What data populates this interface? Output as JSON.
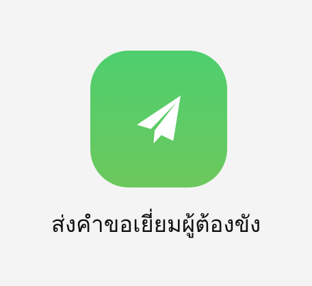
{
  "app": {
    "title": "ส่งคำขอเยี่ยมผู้ต้องขัง",
    "icon": "paper-plane-icon",
    "colors": {
      "background": "#f4f4f4",
      "tile_top": "#4ecf6e",
      "tile_bottom": "#6cc85d",
      "icon": "#ffffff",
      "text": "#111111"
    }
  }
}
